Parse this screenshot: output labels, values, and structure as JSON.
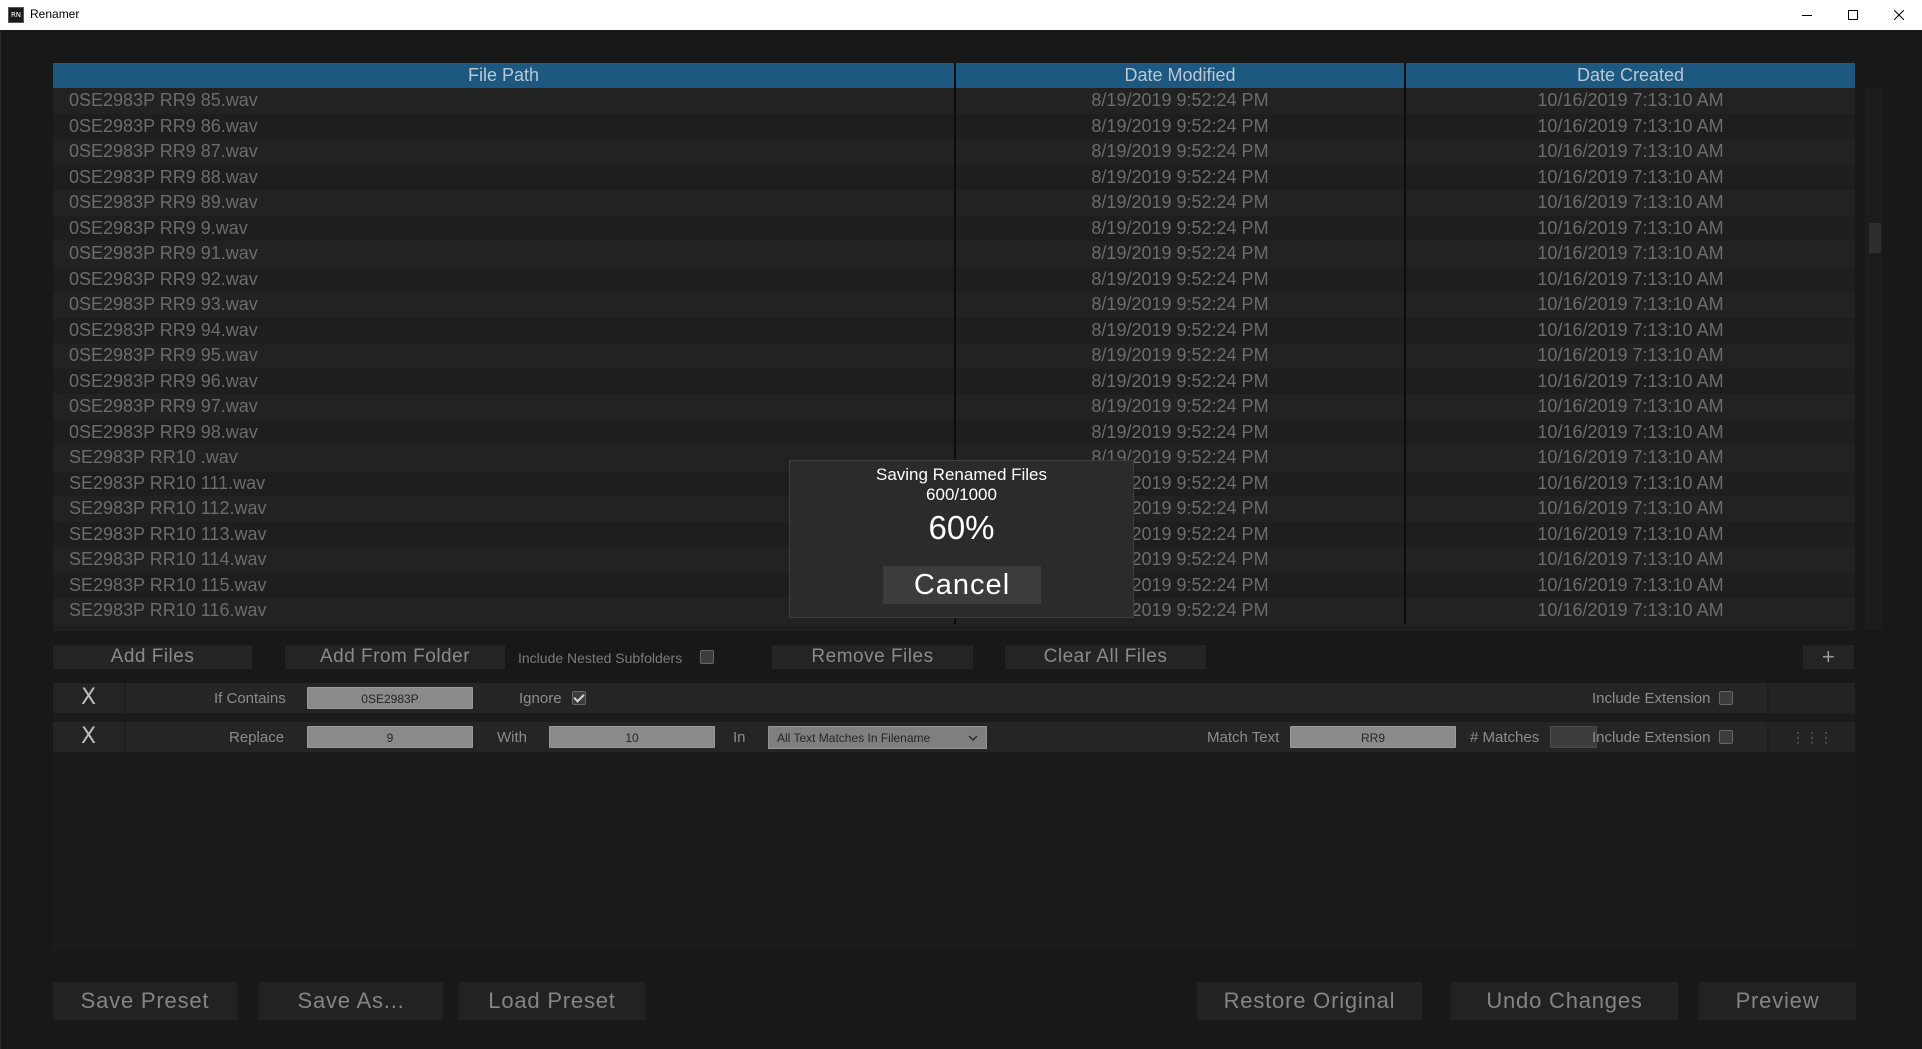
{
  "window": {
    "title": "Renamer",
    "app_icon": "RN",
    "controls": [
      "minimize-icon",
      "maximize-icon",
      "close-icon"
    ]
  },
  "table": {
    "headers": [
      "File Path",
      "Date Modified",
      "Date Created"
    ],
    "rows": [
      {
        "path": "0SE2983P RR9 85.wav",
        "modified": "8/19/2019 9:52:24 PM",
        "created": "10/16/2019 7:13:10 AM"
      },
      {
        "path": "0SE2983P RR9 86.wav",
        "modified": "8/19/2019 9:52:24 PM",
        "created": "10/16/2019 7:13:10 AM"
      },
      {
        "path": "0SE2983P RR9 87.wav",
        "modified": "8/19/2019 9:52:24 PM",
        "created": "10/16/2019 7:13:10 AM"
      },
      {
        "path": "0SE2983P RR9 88.wav",
        "modified": "8/19/2019 9:52:24 PM",
        "created": "10/16/2019 7:13:10 AM"
      },
      {
        "path": "0SE2983P RR9 89.wav",
        "modified": "8/19/2019 9:52:24 PM",
        "created": "10/16/2019 7:13:10 AM"
      },
      {
        "path": "0SE2983P RR9 9.wav",
        "modified": "8/19/2019 9:52:24 PM",
        "created": "10/16/2019 7:13:10 AM"
      },
      {
        "path": "0SE2983P RR9 91.wav",
        "modified": "8/19/2019 9:52:24 PM",
        "created": "10/16/2019 7:13:10 AM"
      },
      {
        "path": "0SE2983P RR9 92.wav",
        "modified": "8/19/2019 9:52:24 PM",
        "created": "10/16/2019 7:13:10 AM"
      },
      {
        "path": "0SE2983P RR9 93.wav",
        "modified": "8/19/2019 9:52:24 PM",
        "created": "10/16/2019 7:13:10 AM"
      },
      {
        "path": "0SE2983P RR9 94.wav",
        "modified": "8/19/2019 9:52:24 PM",
        "created": "10/16/2019 7:13:10 AM"
      },
      {
        "path": "0SE2983P RR9 95.wav",
        "modified": "8/19/2019 9:52:24 PM",
        "created": "10/16/2019 7:13:10 AM"
      },
      {
        "path": "0SE2983P RR9 96.wav",
        "modified": "8/19/2019 9:52:24 PM",
        "created": "10/16/2019 7:13:10 AM"
      },
      {
        "path": "0SE2983P RR9 97.wav",
        "modified": "8/19/2019 9:52:24 PM",
        "created": "10/16/2019 7:13:10 AM"
      },
      {
        "path": "0SE2983P RR9 98.wav",
        "modified": "8/19/2019 9:52:24 PM",
        "created": "10/16/2019 7:13:10 AM"
      },
      {
        "path": "SE2983P RR10 .wav",
        "modified": "8/19/2019 9:52:24 PM",
        "created": "10/16/2019 7:13:10 AM"
      },
      {
        "path": "SE2983P RR10 111.wav",
        "modified": "8/19/2019 9:52:24 PM",
        "created": "10/16/2019 7:13:10 AM"
      },
      {
        "path": "SE2983P RR10 112.wav",
        "modified": "8/19/2019 9:52:24 PM",
        "created": "10/16/2019 7:13:10 AM"
      },
      {
        "path": "SE2983P RR10 113.wav",
        "modified": "8/19/2019 9:52:24 PM",
        "created": "10/16/2019 7:13:10 AM"
      },
      {
        "path": "SE2983P RR10 114.wav",
        "modified": "8/19/2019 9:52:24 PM",
        "created": "10/16/2019 7:13:10 AM"
      },
      {
        "path": "SE2983P RR10 115.wav",
        "modified": "8/19/2019 9:52:24 PM",
        "created": "10/16/2019 7:13:10 AM"
      },
      {
        "path": "SE2983P RR10 116.wav",
        "modified": "8/19/2019 9:52:24 PM",
        "created": "10/16/2019 7:13:10 AM"
      }
    ]
  },
  "file_buttons": {
    "add_files": "Add Files",
    "add_from_folder": "Add From Folder",
    "include_nested": "Include Nested Subfolders",
    "include_nested_checked": false,
    "remove_files": "Remove Files",
    "clear_all": "Clear All Files",
    "add_rule": "+"
  },
  "rules": [
    {
      "remove": "X",
      "type": "If Contains",
      "value": "0SE2983P",
      "ignore_label": "Ignore",
      "ignore_checked": true,
      "include_ext_label": "Include Extension",
      "include_ext_checked": false
    },
    {
      "remove": "X",
      "type": "Replace",
      "value": "9",
      "with_label": "With",
      "with_value": "10",
      "in_label": "In",
      "in_select": "All Text Matches In Filename",
      "match_text_label": "Match Text",
      "match_text_value": "RR9",
      "matches_label": "# Matches",
      "matches_value": "",
      "include_ext_label": "Include Extension",
      "include_ext_checked": false,
      "drag_handle": "⋮⋮⋮"
    }
  ],
  "bottom": {
    "save_preset": "Save Preset",
    "save_as": "Save As...",
    "load_preset": "Load Preset",
    "restore_original": "Restore Original",
    "undo_changes": "Undo Changes",
    "preview": "Preview"
  },
  "dialog": {
    "title": "Saving Renamed Files",
    "count": "600/1000",
    "percent": "60%",
    "progress_fraction": 0.6,
    "cancel": "Cancel"
  },
  "colors": {
    "header_bg": "#1d5880",
    "app_bg": "#181818",
    "dialog_bg": "#2b2b2b"
  }
}
